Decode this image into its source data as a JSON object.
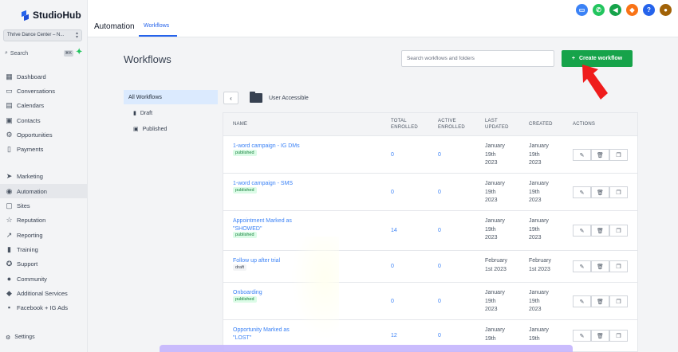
{
  "app": {
    "brand": "StudioHub",
    "account": "Thrive Dance Center – N...",
    "search_label": "Search",
    "search_shortcut": "⌘K"
  },
  "sidebar": {
    "items": [
      {
        "label": "Dashboard",
        "icon": "dashboard-icon"
      },
      {
        "label": "Conversations",
        "icon": "chat-icon"
      },
      {
        "label": "Calendars",
        "icon": "calendar-icon"
      },
      {
        "label": "Contacts",
        "icon": "contacts-icon"
      },
      {
        "label": "Opportunities",
        "icon": "opportunities-icon"
      },
      {
        "label": "Payments",
        "icon": "payments-icon"
      }
    ],
    "items2": [
      {
        "label": "Marketing",
        "icon": "send-icon"
      },
      {
        "label": "Automation",
        "icon": "automation-icon"
      },
      {
        "label": "Sites",
        "icon": "sites-icon"
      },
      {
        "label": "Reputation",
        "icon": "star-icon"
      },
      {
        "label": "Reporting",
        "icon": "chart-icon"
      },
      {
        "label": "Training",
        "icon": "book-icon"
      },
      {
        "label": "Support",
        "icon": "support-icon"
      },
      {
        "label": "Community",
        "icon": "community-icon"
      },
      {
        "label": "Additional Services",
        "icon": "services-icon"
      },
      {
        "label": "Facebook + IG Ads",
        "icon": "ads-icon"
      }
    ],
    "settings": "Settings"
  },
  "header": {
    "title": "Automation",
    "tab": "Workflows"
  },
  "main": {
    "title": "Workflows",
    "search_placeholder": "Search workflows and folders",
    "create_label": "Create workflow",
    "folders": [
      "All Workflows",
      "Draft",
      "Published"
    ],
    "crumb": "User Accessible"
  },
  "table": {
    "headers": {
      "name": "NAME",
      "total_1": "TOTAL",
      "total_2": "ENROLLED",
      "active_1": "ACTIVE",
      "active_2": "ENROLLED",
      "updated_1": "LAST",
      "updated_2": "UPDATED",
      "created": "CREATED",
      "actions": "ACTIONS"
    },
    "rows": [
      {
        "name1": "1-word campaign - IG DMs",
        "name2": "",
        "status": "published",
        "total": "0",
        "active": "0",
        "updated": [
          "January",
          "19th",
          "2023"
        ],
        "created": [
          "January",
          "19th",
          "2023"
        ]
      },
      {
        "name1": "1-word campaign - SMS",
        "name2": "",
        "status": "published",
        "total": "0",
        "active": "0",
        "updated": [
          "January",
          "19th",
          "2023"
        ],
        "created": [
          "January",
          "19th",
          "2023"
        ]
      },
      {
        "name1": "Appointment Marked as",
        "name2": "\"SHOWED\"",
        "status": "published",
        "total": "14",
        "active": "0",
        "updated": [
          "January",
          "19th",
          "2023"
        ],
        "created": [
          "January",
          "19th",
          "2023"
        ]
      },
      {
        "name1": "Follow up after trial",
        "name2": "",
        "status": "draft",
        "total": "0",
        "active": "0",
        "updated": [
          "February",
          "1st 2023",
          ""
        ],
        "created": [
          "February",
          "1st 2023",
          ""
        ]
      },
      {
        "name1": "Onboarding",
        "name2": "",
        "status": "published",
        "total": "0",
        "active": "0",
        "updated": [
          "January",
          "19th",
          "2023"
        ],
        "created": [
          "January",
          "19th",
          "2023"
        ]
      },
      {
        "name1": "Opportunity Marked as",
        "name2": "\"LOST\"",
        "status": "",
        "total": "12",
        "active": "0",
        "updated": [
          "January",
          "19th",
          ""
        ],
        "created": [
          "January",
          "19th",
          ""
        ]
      }
    ]
  },
  "colors": {
    "accent": "#2563eb",
    "create": "#16a34a",
    "badge_bg": "#dcfce7",
    "arrow": "#ef1c1c"
  }
}
